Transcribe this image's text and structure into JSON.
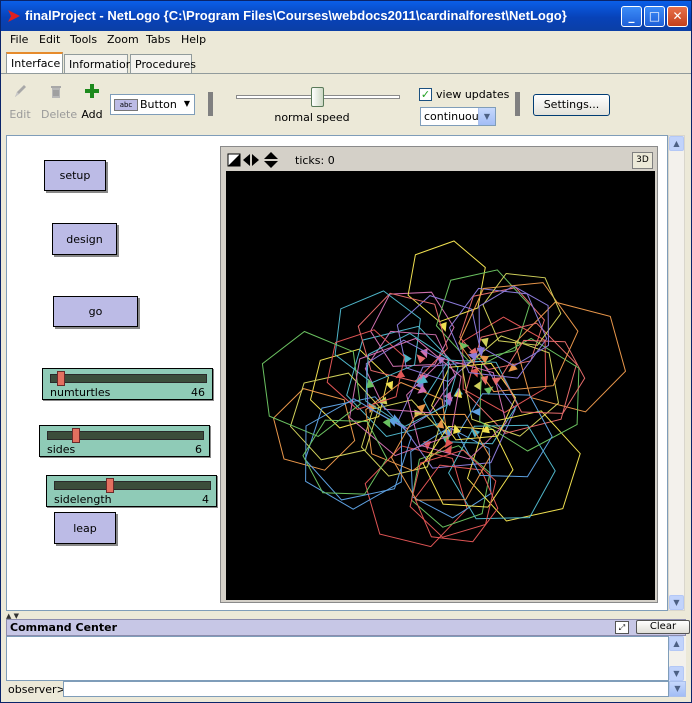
{
  "window": {
    "title": "finalProject - NetLogo {C:\\Program Files\\Courses\\webdocs2011\\cardinalforest\\NetLogo}",
    "minimize": "_",
    "maximize": "□",
    "close": "✕"
  },
  "menubar": [
    "File",
    "Edit",
    "Tools",
    "Zoom",
    "Tabs",
    "Help"
  ],
  "tabs": [
    {
      "label": "Interface",
      "active": true
    },
    {
      "label": "Information",
      "active": false
    },
    {
      "label": "Procedures",
      "active": false
    }
  ],
  "toolbar": {
    "edit_label": "Edit",
    "delete_label": "Delete",
    "add_label": "Add",
    "widget_type": "Button",
    "widget_icon_text": "abc",
    "speed_label": "normal speed",
    "speed_value": 0.5,
    "view_updates_label": "view updates",
    "view_updates_checked": true,
    "update_mode": "continuous",
    "settings_label": "Settings..."
  },
  "widgets": {
    "setup_label": "setup",
    "design_label": "design",
    "go_label": "go",
    "leap_label": "leap",
    "sliders": [
      {
        "name": "numturtles",
        "value": "46",
        "fraction": 0.05
      },
      {
        "name": "sides",
        "value": "6",
        "fraction": 0.17
      },
      {
        "name": "sidelength",
        "value": "4",
        "fraction": 0.35
      }
    ]
  },
  "view": {
    "ticks_text": "ticks: 0",
    "button_3d": "3D",
    "background": "#000000"
  },
  "command_center": {
    "title": "Command Center",
    "clear_label": "Clear",
    "prompt": "observer>",
    "input_value": ""
  },
  "colors": {
    "button_fill": "#bcbbe6",
    "slider_fill": "#8fcbb7",
    "titlebar": "#0a5fe8"
  }
}
